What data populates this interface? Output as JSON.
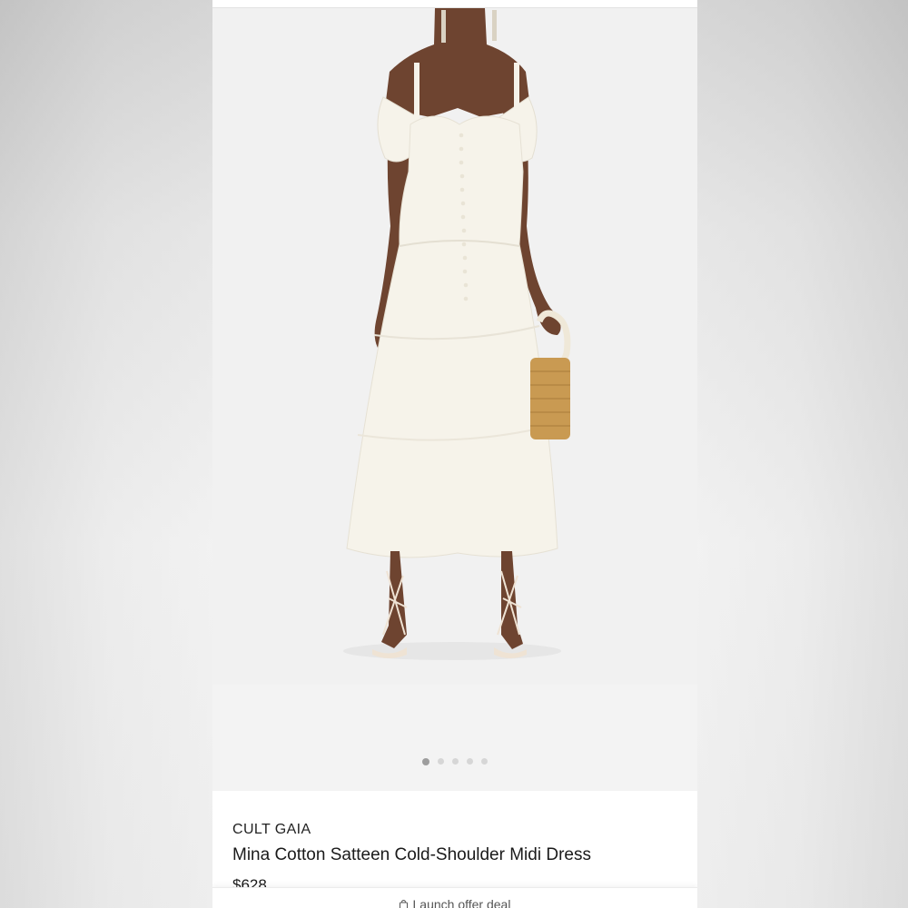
{
  "product": {
    "brand": "CULT GAIA",
    "title": "Mina Cotton Satteen Cold-Shoulder Midi Dress",
    "price": "$628"
  },
  "gallery": {
    "image_alt": "Model wearing white cold-shoulder midi dress holding a wicker basket bag",
    "slides": 5,
    "active_slide": 1
  },
  "bottom_bar": {
    "label": "Launch offer deal",
    "icon": "bag-icon"
  },
  "colors": {
    "background": "#f7f7f7",
    "photo_background": "#f1f1f1",
    "dress": "#f6f3ea",
    "skin": "#6e4430",
    "bag": "#c99a52",
    "dot_active": "#9d9d9d",
    "dot_inactive": "#d6d6d6"
  }
}
